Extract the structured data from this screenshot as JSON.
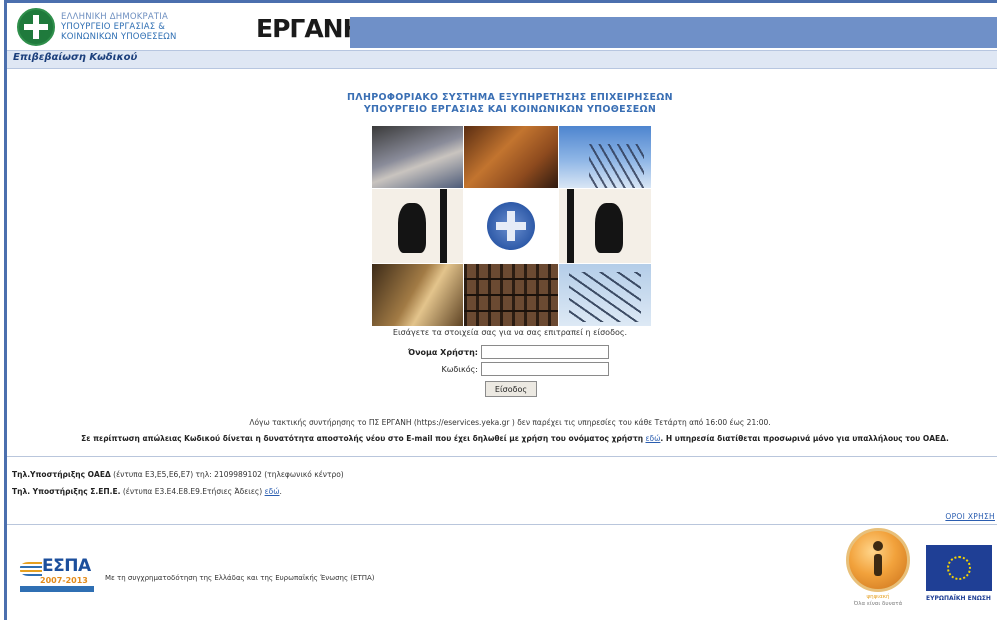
{
  "header": {
    "ministry_line1": "ΕΛΛΗΝΙΚΗ ΔΗΜΟΚΡΑΤΙΑ",
    "ministry_line2": "ΥΠΟΥΡΓΕΙΟ ΕΡΓΑΣΙΑΣ &",
    "ministry_line3": "ΚΟΙΝΩΝΙΚΩΝ ΥΠΟΘΕΣΕΩΝ",
    "brand": "ΕΡΓΑΝΗ"
  },
  "title_bar": {
    "label": "Επιβεβαίωση Κωδικού"
  },
  "main": {
    "title_line1": "ΠΛΗΡΟΦΟΡΙΑΚΟ ΣΥΣΤΗΜΑ ΕΞΥΠΗΡΕΤΗΣΗΣ ΕΠΙΧΕΙΡΗΣΕΩΝ",
    "title_line2": "ΥΠΟΥΡΓΕΙΟ ΕΡΓΑΣΙΑΣ ΚΑΙ ΚΟΙΝΩΝΙΚΩΝ ΥΠΟΘΕΣΕΩΝ",
    "prompt": "Εισάγετε τα στοιχεία σας για να σας επιτραπεί η είσοδος.",
    "username_label": "Όνομα Χρήστη:",
    "username_value": "",
    "password_label": "Κωδικός:",
    "password_value": "",
    "login_button": "Είσοδος"
  },
  "notices": {
    "maintenance": "Λόγω τακτικής συντήρησης το ΠΣ ΕΡΓΑΝΗ (https://eservices.yeka.gr ) δεν παρέχει τις υπηρεσίες του κάθε Τετάρτη από 16:00 έως 21:00.",
    "lost_password_pre": "Σε περίπτωση απώλειας Κωδικού δίνεται η δυνατότητα αποστολής νέου στο E-mail που έχει δηλωθεί με χρήση του ονόματος χρήστη",
    "lost_password_link": "εδώ",
    "lost_password_post": ". Η υπηρεσία διατίθεται προσωρινά μόνο για υπαλλήλους του ΟΑΕΔ."
  },
  "support": {
    "oaed_label": "Τηλ.Υποστήριξης ΟΑΕΔ",
    "oaed_detail": "(έντυπα Ε3,Ε5,Ε6,Ε7) τηλ: 2109989102 (τηλεφωνικό κέντρο)",
    "sepe_label": "Τηλ. Υποστήριξης Σ.ΕΠ.Ε.",
    "sepe_detail": "(έντυπα Ε3.Ε4.Ε8.Ε9.Ετήσιες Άδειες)",
    "sepe_link": "εδώ",
    "sepe_end": ".",
    "terms_link": "ΟΡΟΙ ΧΡΗΣΗ"
  },
  "footer": {
    "espa_title": "ΕΣΠΑ",
    "espa_years": "2007-2013",
    "cofunding": "Με τη συγχρηματοδότηση της Ελλάδας και της Ευρωπαϊκής Ένωσης (ΕΤΠΑ)",
    "digital_line1": "ψηφιακή",
    "digital_line2": "Όλα είναι δυνατά",
    "eu_label": "ΕΥΡΩΠΑΪΚΗ ΕΝΩΣΗ"
  }
}
